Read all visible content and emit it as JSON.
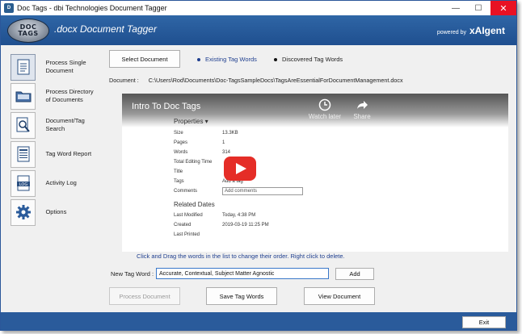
{
  "window": {
    "title": "Doc Tags - dbi Technologies Document Tagger",
    "controls": {
      "minimize": "—",
      "maximize": "☐",
      "close": "✕"
    }
  },
  "header": {
    "logo_top": "DOC",
    "logo_bottom": "TAGS",
    "title": ".docx Document Tagger",
    "powered_prefix": "powered by",
    "powered_brand": "xAIgent"
  },
  "sidebar": {
    "items": [
      {
        "label": "Process Single Document",
        "icon": "document-icon"
      },
      {
        "label": "Process Directory of Documents",
        "icon": "folder-icon"
      },
      {
        "label": "Document/Tag Search",
        "icon": "search-icon"
      },
      {
        "label": "Tag Word Report",
        "icon": "report-icon"
      },
      {
        "label": "Activity Log",
        "icon": "log-icon"
      },
      {
        "label": "Options",
        "icon": "gear-icon"
      }
    ]
  },
  "main": {
    "select_document": "Select Document",
    "radio_existing": "Existing Tag Words",
    "radio_discovered": "Discovered Tag Words",
    "document_label": "Document :",
    "document_path": "C:\\Users\\Rod\\Documents\\Doc-TagsSampleDocs\\TagsAreEssentialForDocumentManagement.docx",
    "hint": "Click and Drag the words in the list to change their order. Right click to delete.",
    "new_tag_label": "New Tag Word :",
    "new_tag_value": "Accurate, Contextual, Subject Matter Agnostic",
    "add": "Add",
    "process_document": "Process Document",
    "save_tag_words": "Save Tag Words",
    "view_document": "View Document",
    "exit": "Exit"
  },
  "video": {
    "title": "Intro To Doc Tags",
    "watch_later": "Watch later",
    "share": "Share",
    "properties_heading": "Properties ▾",
    "properties": [
      {
        "k": "Size",
        "v": "13.3KB"
      },
      {
        "k": "Pages",
        "v": "1"
      },
      {
        "k": "Words",
        "v": "314"
      },
      {
        "k": "Total Editing Time",
        "v": ""
      },
      {
        "k": "Title",
        "v": ""
      },
      {
        "k": "Tags",
        "v": "Add a tag"
      }
    ],
    "comments_label": "Comments",
    "comments_placeholder": "Add comments",
    "related_heading": "Related Dates",
    "dates": [
      {
        "k": "Last Modified",
        "v": "Today, 4:38 PM"
      },
      {
        "k": "Created",
        "v": "2019-03-19 11:25 PM"
      },
      {
        "k": "Last Printed",
        "v": ""
      }
    ]
  },
  "colors": {
    "header": "#2f66a6",
    "footer": "#2a5b9b",
    "accent": "#1f3f8f"
  }
}
